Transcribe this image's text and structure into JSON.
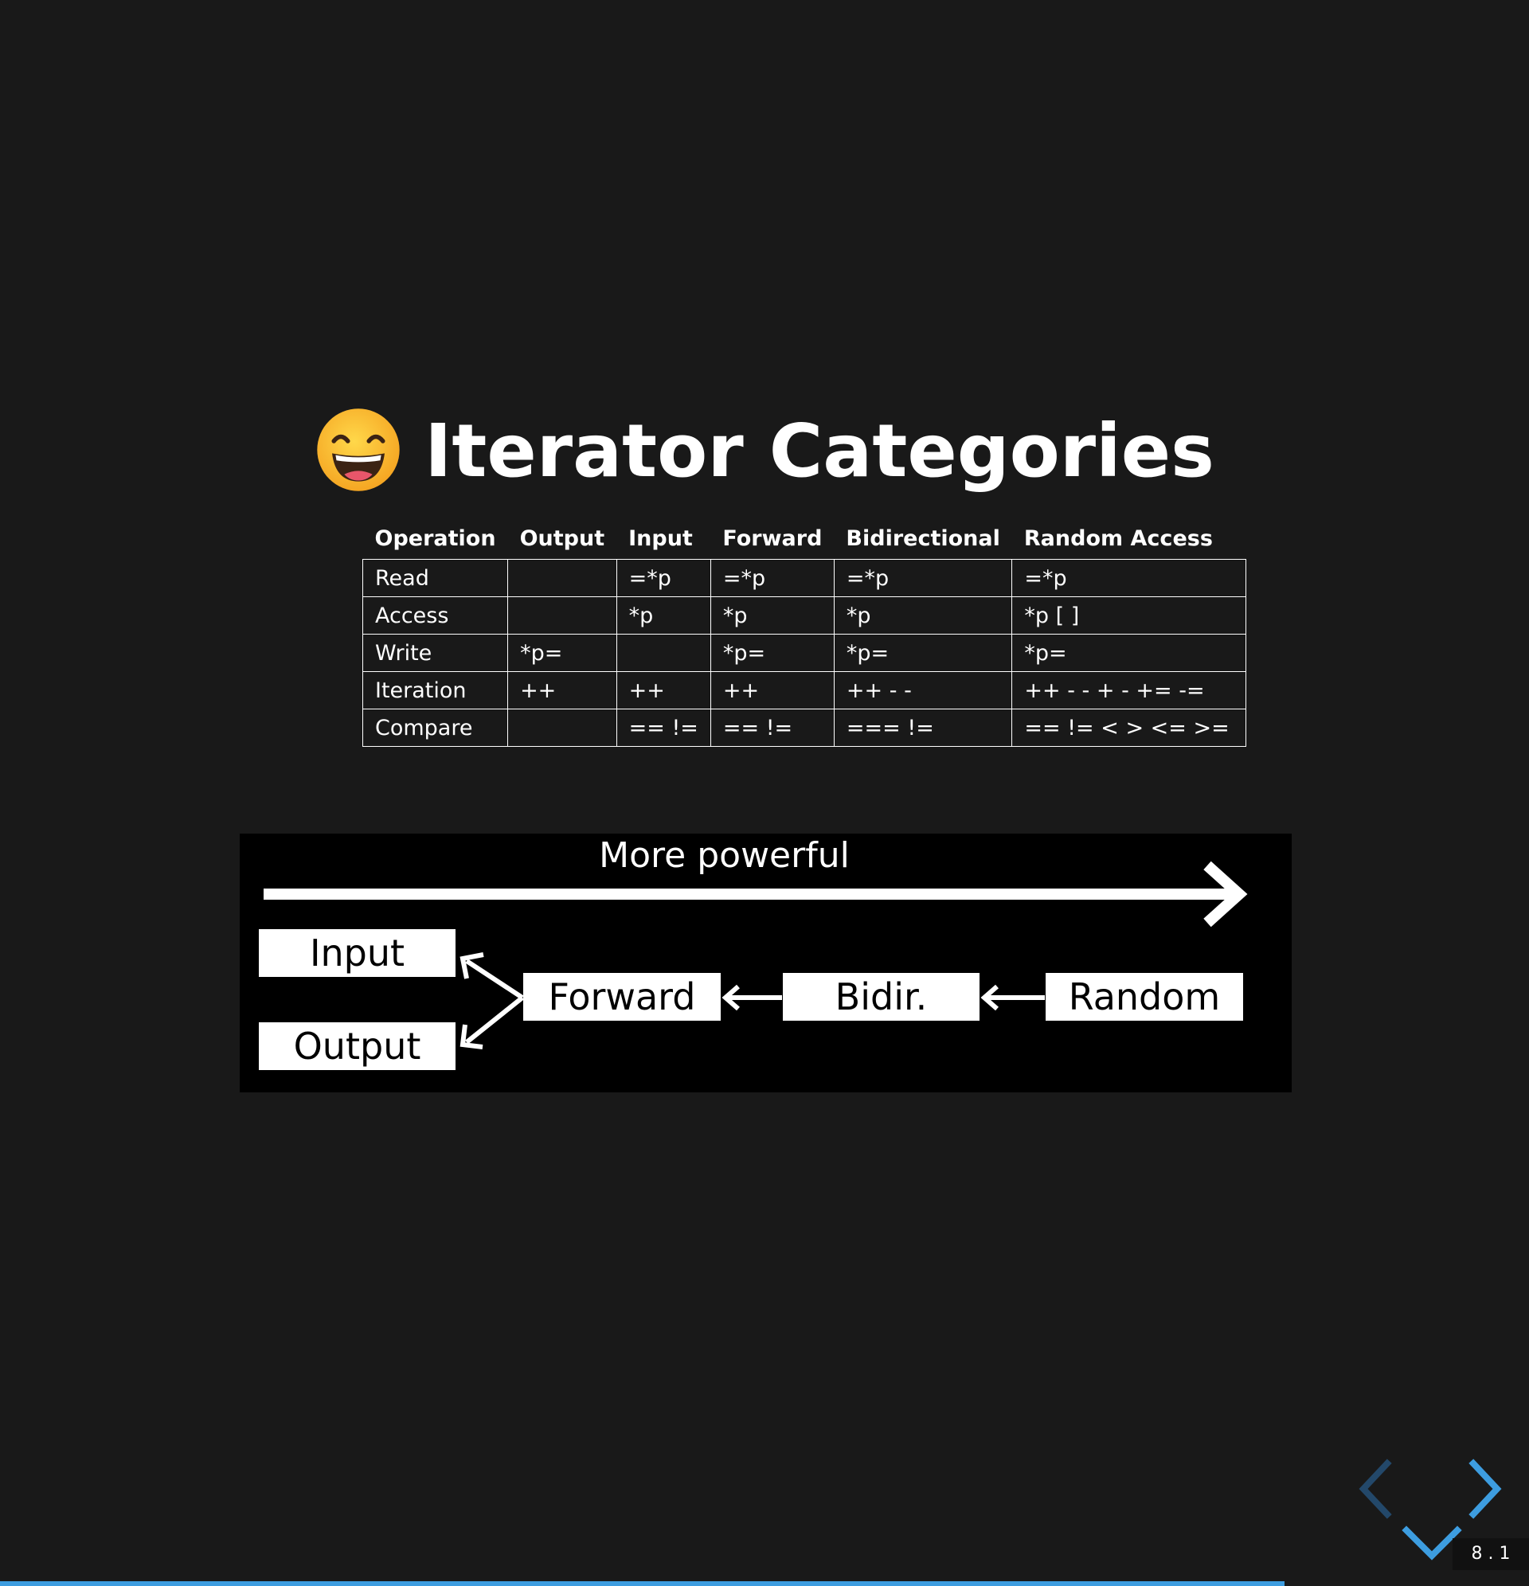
{
  "slide": {
    "title": "Iterator Categories",
    "title_icon": "grinning-smiling-eyes-emoji"
  },
  "table": {
    "headers": [
      "Operation",
      "Output",
      "Input",
      "Forward",
      "Bidirectional",
      "Random Access"
    ],
    "rows": [
      [
        "Read",
        "",
        "=*p",
        "=*p",
        "=*p",
        "=*p"
      ],
      [
        "Access",
        "",
        "*p",
        "*p",
        "*p",
        "*p  [ ]"
      ],
      [
        "Write",
        "*p=",
        "",
        "*p=",
        "*p=",
        "*p="
      ],
      [
        "Iteration",
        "++",
        "++",
        "++",
        "++  - -",
        "++  - -  +  -  +=  -="
      ],
      [
        "Compare",
        "",
        "==  !=",
        "==  !=",
        "===  !=",
        "==  !=  <  >  <=  >="
      ]
    ]
  },
  "diagram": {
    "arrow_label": "More powerful",
    "boxes": {
      "input": "Input",
      "output": "Output",
      "forward": "Forward",
      "bidir": "Bidir.",
      "random": "Random"
    }
  },
  "navigation": {
    "prev_icon": "chevron-left-icon",
    "next_icon": "chevron-right-icon",
    "down_icon": "chevron-down-icon",
    "page_number": "8 . 1",
    "progress": 0.84,
    "accent_color": "#3d9de0"
  }
}
